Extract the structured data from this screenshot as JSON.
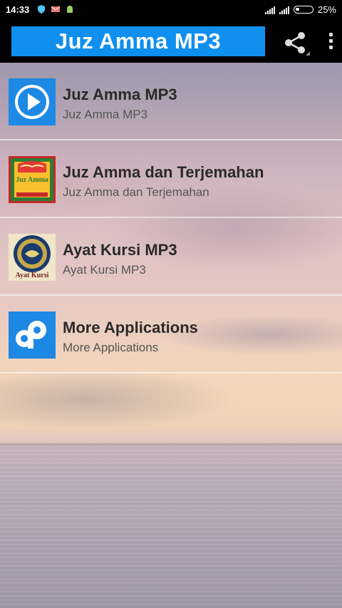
{
  "status": {
    "time": "14:33",
    "battery": "25%"
  },
  "actionbar": {
    "title": "Juz Amma MP3"
  },
  "items": [
    {
      "title": "Juz Amma MP3",
      "subtitle": "Juz Amma MP3",
      "icon": "play-icon"
    },
    {
      "title": "Juz Amma dan Terjemahan",
      "subtitle": "Juz Amma dan Terjemahan",
      "icon": "juz-amma-book-icon",
      "icon_text": "Juz Amma"
    },
    {
      "title": "Ayat Kursi MP3",
      "subtitle": "Ayat Kursi MP3",
      "icon": "ayat-kursi-icon",
      "icon_text": "Ayat Kursi"
    },
    {
      "title": "More Applications",
      "subtitle": "More Applications",
      "icon": "more-apps-icon"
    }
  ],
  "colors": {
    "accent": "#0f8ff0",
    "statusbar": "#000000"
  }
}
